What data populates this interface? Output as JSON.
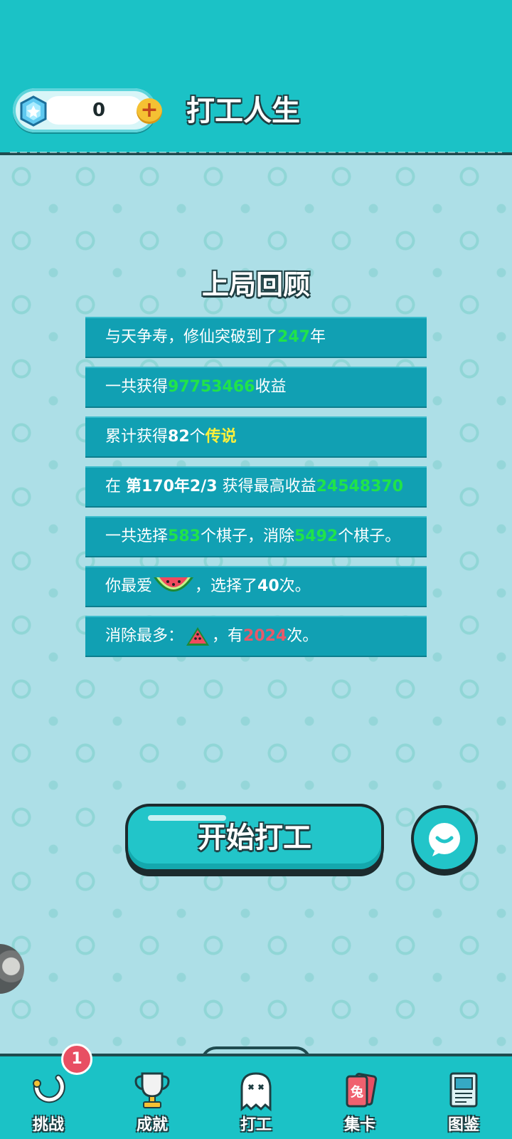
{
  "header": {
    "gem_count": "0",
    "plus_label": "+",
    "title": "打工人生"
  },
  "review": {
    "title": "上局回顾",
    "rows": [
      {
        "parts": [
          "与天争寿，修仙突破到了",
          "247",
          "年"
        ]
      },
      {
        "parts": [
          "一共获得",
          "97753466",
          "收益"
        ]
      },
      {
        "parts": [
          "累计获得",
          "82",
          "个",
          "传说"
        ]
      },
      {
        "parts": [
          "在 ",
          "第170年2/3",
          " 获得最高收益",
          "24548370"
        ]
      },
      {
        "parts": [
          "一共选择",
          "583",
          "个棋子，消除",
          "5492",
          "个棋子。"
        ]
      },
      {
        "parts": [
          "你最爱",
          "，选择了",
          "40",
          "次。"
        ]
      },
      {
        "parts": [
          "消除最多：",
          "，有",
          "2024",
          "次。"
        ]
      }
    ]
  },
  "actions": {
    "start_label": "开始打工"
  },
  "nav": {
    "items": [
      {
        "label": "挑战",
        "icon": "challenge-icon"
      },
      {
        "label": "成就",
        "icon": "trophy-icon"
      },
      {
        "label": "打工",
        "icon": "ghost-icon"
      },
      {
        "label": "集卡",
        "icon": "card-icon"
      },
      {
        "label": "图鉴",
        "icon": "book-icon"
      }
    ],
    "badge": "1",
    "card_char": "兔"
  },
  "colors": {
    "header_bg": "#1bc2c6",
    "row_bg": "#11a0b3",
    "highlight_green": "#20e34a",
    "highlight_yellow": "#fff03a",
    "highlight_red": "#e65a6a"
  }
}
